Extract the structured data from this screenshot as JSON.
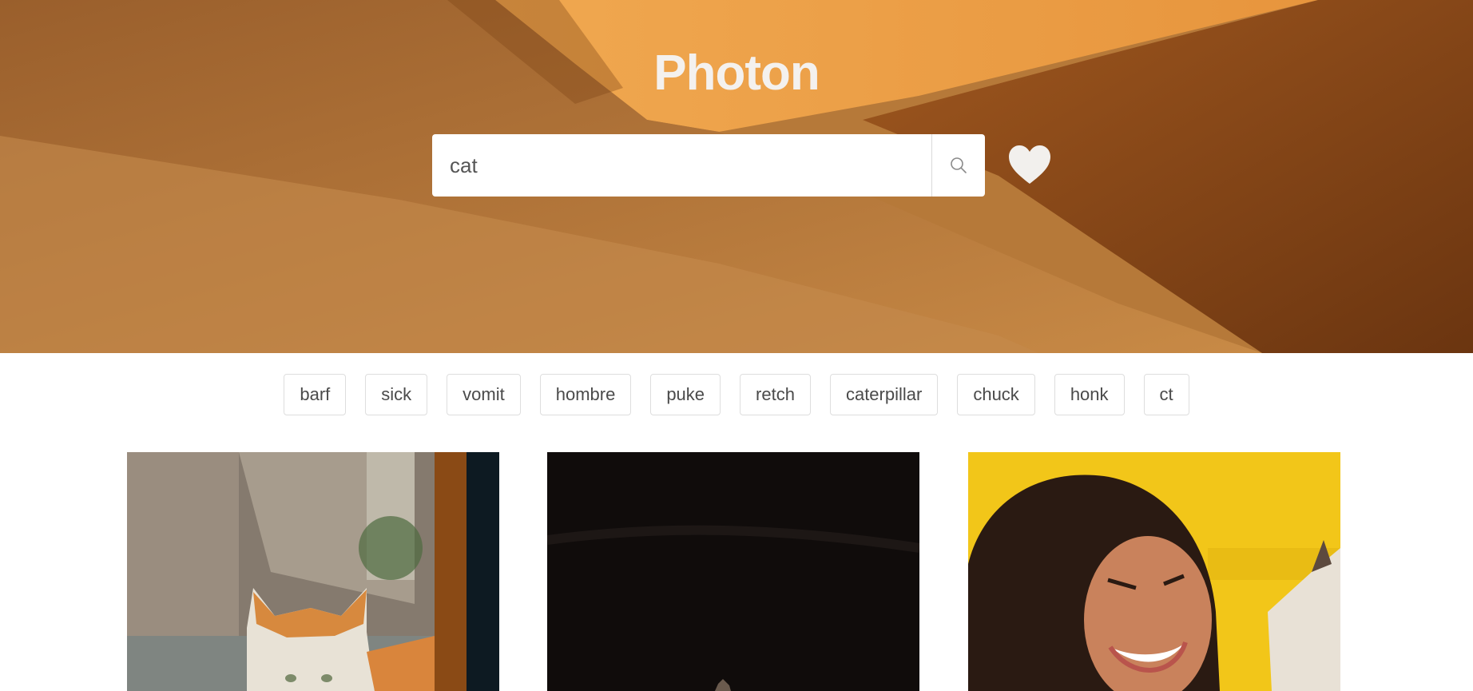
{
  "app": {
    "title": "Photon"
  },
  "search": {
    "value": "cat",
    "placeholder": ""
  },
  "icons": {
    "search": "search-icon",
    "favorites": "heart-icon"
  },
  "colors": {
    "hero_sand": "#b97a3c",
    "heart": "#f2f0ed",
    "tag_border": "#dedede"
  },
  "tags": [
    "barf",
    "sick",
    "vomit",
    "hombre",
    "puke",
    "retch",
    "caterpillar",
    "chuck",
    "honk",
    "ct"
  ],
  "photos": [
    {
      "subject": "orange tabby cat by doorway"
    },
    {
      "subject": "cat on dark background"
    },
    {
      "subject": "smiling woman with curly hair holding cat on yellow background"
    }
  ]
}
